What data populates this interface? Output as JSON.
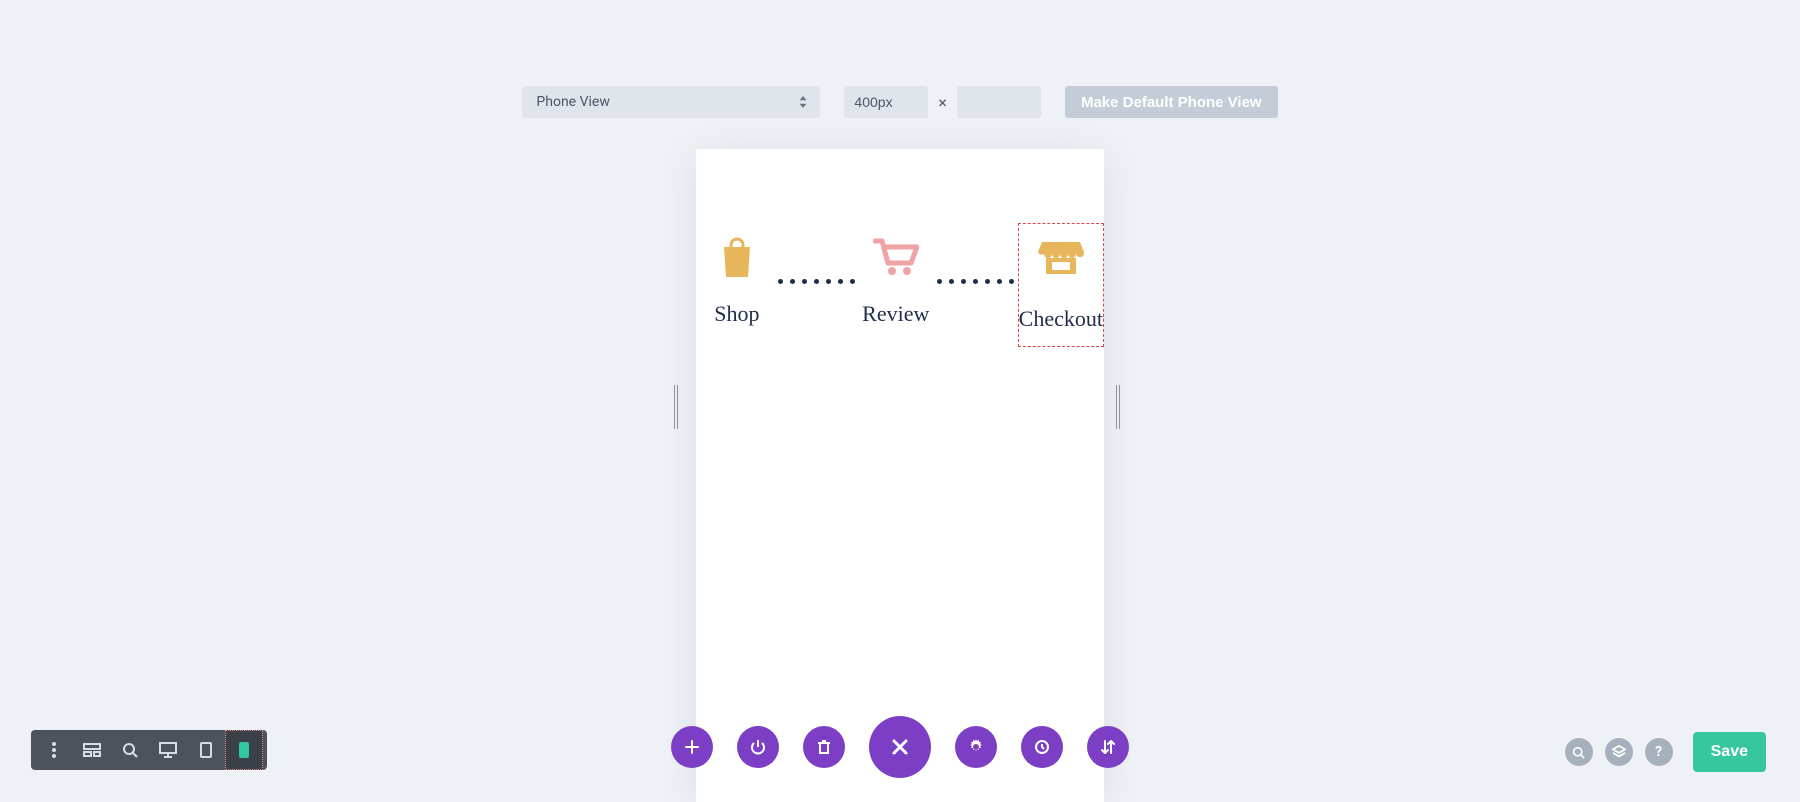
{
  "toolbar": {
    "view_select_label": "Phone View",
    "width_value": "400px",
    "height_value": "",
    "x_label": "×",
    "default_button_label": "Make Default Phone View"
  },
  "steps": [
    {
      "label": "Shop",
      "icon": "bag"
    },
    {
      "label": "Review",
      "icon": "cart"
    },
    {
      "label": "Checkout",
      "icon": "store"
    }
  ],
  "bottom_left": {
    "items": [
      "more",
      "wireframe",
      "zoom",
      "desktop",
      "tablet",
      "phone"
    ],
    "active": "phone"
  },
  "center_actions": {
    "add": "+",
    "power": "power",
    "trash": "trash",
    "close": "close",
    "settings": "gear",
    "history": "clock",
    "sort": "sort"
  },
  "right_actions": {
    "zoom": "zoom",
    "layers": "layers",
    "help": "?",
    "save_label": "Save"
  },
  "colors": {
    "bg": "#eef2f7",
    "panel": "#e0e5ec",
    "purple": "#7c3ec4",
    "green": "#36c79f",
    "toolbar_dark": "#4d535c",
    "step_icon_yellow": "#e7b65a",
    "step_icon_pink": "#efa3a3",
    "step_text": "#1f2d4a",
    "selected_border": "#d44a4a"
  }
}
